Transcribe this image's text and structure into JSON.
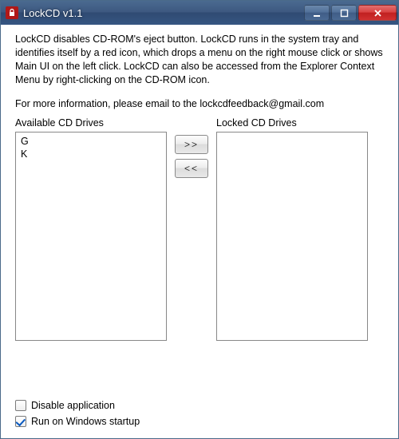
{
  "window": {
    "title": "LockCD v1.1"
  },
  "description": "LockCD disables CD-ROM's eject button. LockCD runs in the system tray and identifies itself by a red icon, which drops a menu on the right mouse click or shows Main UI on the left click. LockCD can also be accessed from the Explorer Context Menu by right-clicking on the CD-ROM icon.",
  "info_line": "For more information, please email to the  lockcdfeedback@gmail.com",
  "lists": {
    "available": {
      "label": "Available CD Drives",
      "items": [
        "G",
        "K"
      ]
    },
    "locked": {
      "label": "Locked CD Drives",
      "items": []
    }
  },
  "buttons": {
    "move_right": ">>",
    "move_left": "<<"
  },
  "checkboxes": {
    "disable": {
      "label": "Disable application",
      "checked": false
    },
    "startup": {
      "label": "Run on Windows startup",
      "checked": true
    }
  }
}
